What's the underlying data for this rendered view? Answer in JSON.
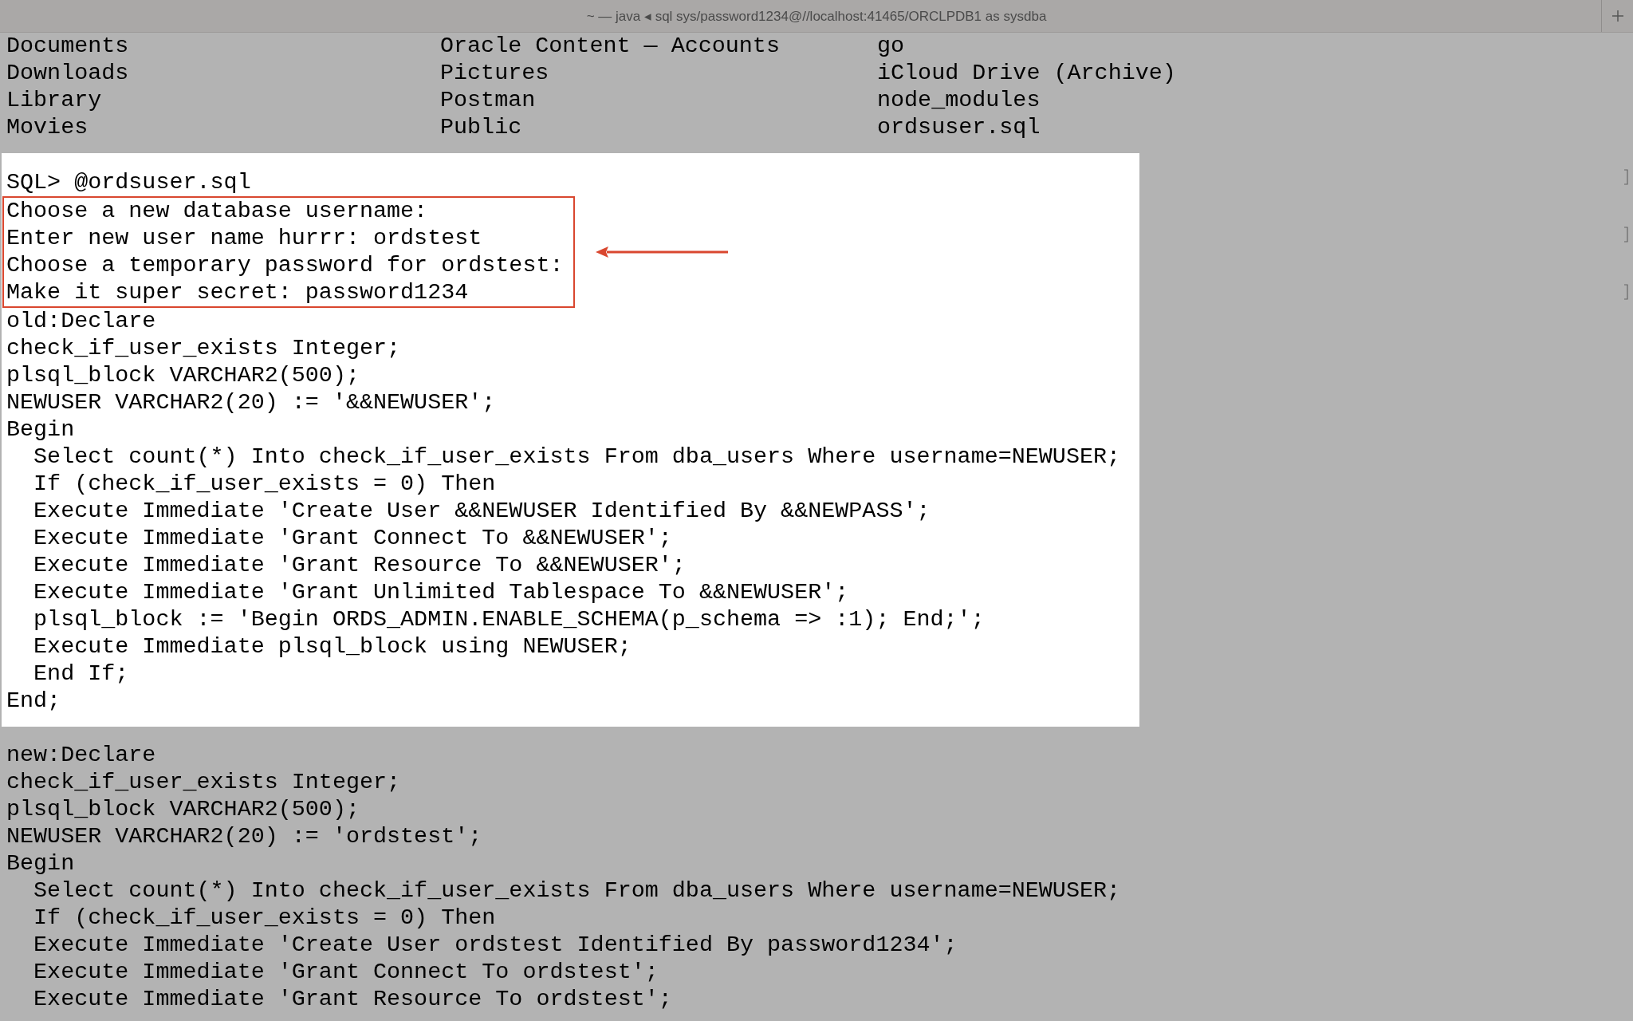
{
  "window": {
    "title": "~ — java ◂ sql sys/password1234@//localhost:41465/ORCLPDB1 as sysdba"
  },
  "listing": {
    "columns": [
      [
        "Documents",
        "Downloads",
        "Library",
        "Movies"
      ],
      [
        "Oracle Content — Accounts",
        "Pictures",
        "Postman",
        "Public"
      ],
      [
        "go",
        "iCloud Drive (Archive)",
        "node_modules",
        "ordsuser.sql"
      ]
    ]
  },
  "highlighted_output": {
    "lines_before": [
      "SQL> @ordsuser.sql"
    ],
    "annotated_lines": [
      "Choose a new database username:",
      "Enter new user name hurrr: ordstest",
      "Choose a temporary password for ordstest:",
      "Make it super secret: password1234"
    ],
    "lines_after": [
      "old:Declare",
      "check_if_user_exists Integer;",
      "plsql_block VARCHAR2(500);",
      "NEWUSER VARCHAR2(20) := '&&NEWUSER';",
      "Begin",
      "  Select count(*) Into check_if_user_exists From dba_users Where username=NEWUSER;",
      "  If (check_if_user_exists = 0) Then",
      "  Execute Immediate 'Create User &&NEWUSER Identified By &&NEWPASS';",
      "  Execute Immediate 'Grant Connect To &&NEWUSER';",
      "  Execute Immediate 'Grant Resource To &&NEWUSER';",
      "  Execute Immediate 'Grant Unlimited Tablespace To &&NEWUSER';",
      "  plsql_block := 'Begin ORDS_ADMIN.ENABLE_SCHEMA(p_schema => :1); End;';",
      "  Execute Immediate plsql_block using NEWUSER;",
      "  End If;",
      "End;"
    ]
  },
  "output_lines": [
    "new:Declare",
    "check_if_user_exists Integer;",
    "plsql_block VARCHAR2(500);",
    "NEWUSER VARCHAR2(20) := 'ordstest';",
    "Begin",
    "  Select count(*) Into check_if_user_exists From dba_users Where username=NEWUSER;",
    "  If (check_if_user_exists = 0) Then",
    "  Execute Immediate 'Create User ordstest Identified By password1234';",
    "  Execute Immediate 'Grant Connect To ordstest';",
    "  Execute Immediate 'Grant Resource To ordstest';"
  ]
}
